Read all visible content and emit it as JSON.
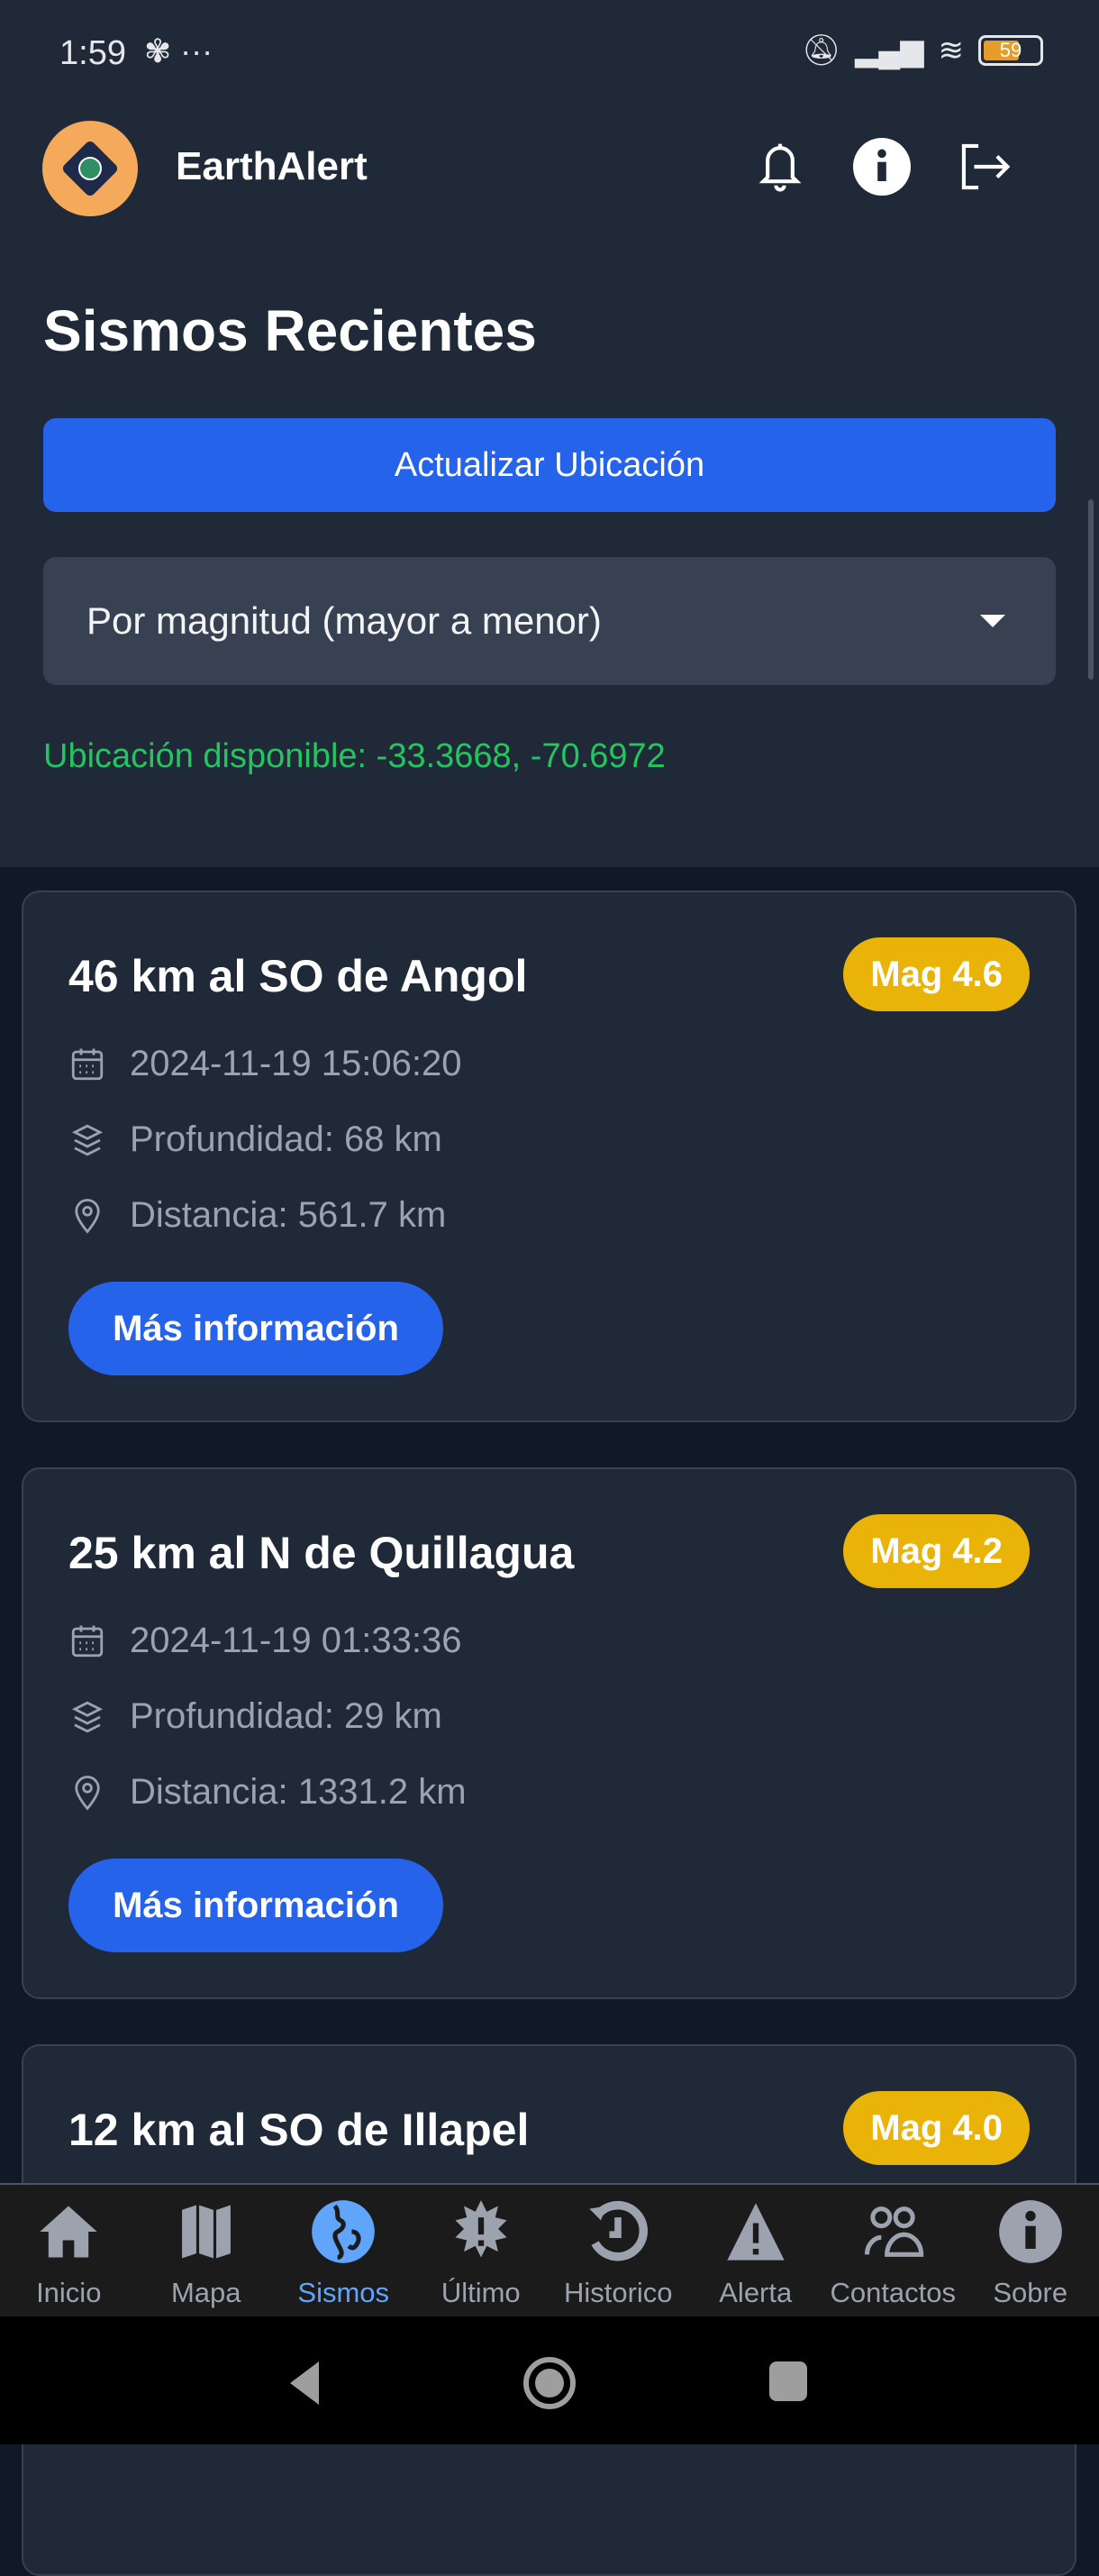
{
  "status_bar": {
    "time": "1:59",
    "battery": "59"
  },
  "header": {
    "app_name": "EarthAlert"
  },
  "page": {
    "title": "Sismos Recientes",
    "update_button": "Actualizar Ubicación",
    "sort_select": "Por magnitud (mayor a menor)",
    "location_status": "Ubicación disponible: -33.3668, -70.6972"
  },
  "colors": {
    "accent": "#2563eb",
    "badge": "#eab308",
    "success": "#22c55e"
  },
  "quakes": [
    {
      "title": "46 km al SO de Angol",
      "magnitude": "Mag 4.6",
      "datetime": "2024-11-19 15:06:20",
      "depth": "Profundidad: 68 km",
      "distance": "Distancia: 561.7 km",
      "button": "Más información"
    },
    {
      "title": "25 km al N de Quillagua",
      "magnitude": "Mag 4.2",
      "datetime": "2024-11-19 01:33:36",
      "depth": "Profundidad: 29 km",
      "distance": "Distancia: 1331.2 km",
      "button": "Más información"
    },
    {
      "title": "12 km al SO de Illapel",
      "magnitude": "Mag 4.0"
    }
  ],
  "nav": [
    {
      "label": "Inicio",
      "icon": "home-icon"
    },
    {
      "label": "Mapa",
      "icon": "map-icon"
    },
    {
      "label": "Sismos",
      "icon": "globe-icon"
    },
    {
      "label": "Último",
      "icon": "alert-burst-icon"
    },
    {
      "label": "Historico",
      "icon": "history-icon"
    },
    {
      "label": "Alerta",
      "icon": "warning-icon"
    },
    {
      "label": "Contactos",
      "icon": "contacts-icon"
    },
    {
      "label": "Sobre",
      "icon": "info-icon"
    }
  ]
}
